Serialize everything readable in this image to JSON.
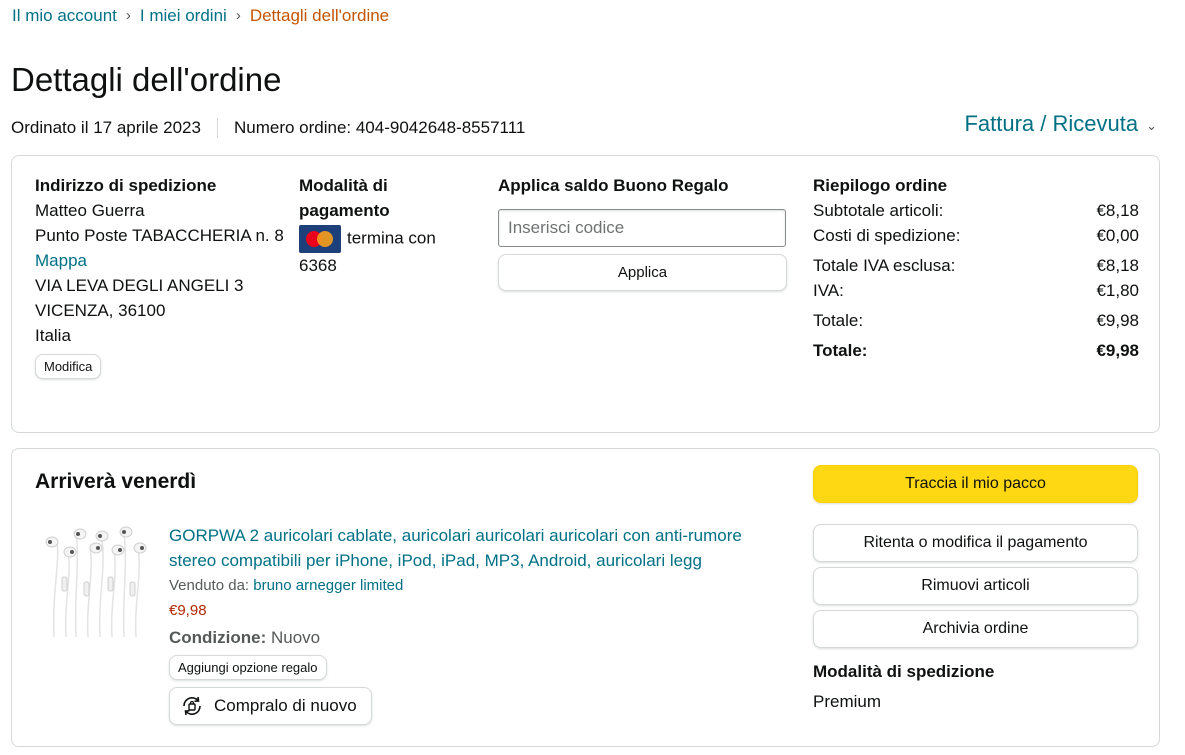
{
  "breadcrumb": {
    "items": [
      "Il mio account",
      "I miei ordini"
    ],
    "current": "Dettagli dell'ordine",
    "separator": "›"
  },
  "page": {
    "title": "Dettagli dell'ordine",
    "ordered_on": "Ordinato il 17 aprile 2023",
    "order_number": "Numero ordine: 404-9042648-8557111",
    "invoice_label": "Fattura / Ricevuta",
    "invoice_chevron_icon": "chevron-down-icon"
  },
  "shipping_address": {
    "title": "Indirizzo di spedizione",
    "name": "Matteo Guerra",
    "line1": "Punto Poste TABACCHERIA n. 8",
    "map_link": "Mappa",
    "line2": "VIA LEVA DEGLI ANGELI 3",
    "city": "VICENZA, 36100",
    "country": "Italia",
    "edit_button": "Modifica"
  },
  "payment": {
    "title_line1": "Modalità di",
    "title_line2": "pagamento",
    "card_icon": "mastercard-icon",
    "ending_text": "termina con",
    "last_digits": "6368"
  },
  "gift_card": {
    "title": "Applica saldo Buono Regalo",
    "placeholder": "Inserisci codice",
    "apply_button": "Applica"
  },
  "summary": {
    "title": "Riepilogo ordine",
    "rows": [
      {
        "label": "Subtotale articoli:",
        "value": "€8,18"
      },
      {
        "label": "Costi di spedizione:",
        "value": "€0,00"
      },
      {
        "label": "Totale IVA esclusa:",
        "value": "€8,18"
      },
      {
        "label": "IVA:",
        "value": "€1,80"
      },
      {
        "label": "Totale:",
        "value": "€9,98"
      },
      {
        "label": "Totale:",
        "value": "€9,98"
      }
    ]
  },
  "shipment": {
    "arrival_title": "Arriverà venerdì",
    "product_title": "GORPWA 2 auricolari cablate, auricolari auricolari auricolari con anti-rumore stereo compatibili per iPhone, iPod, iPad, MP3, Android, auricolari legg",
    "sold_by_label": "Venduto da:",
    "seller": "bruno arnegger limited",
    "price": "€9,98",
    "condition_label": "Condizione:",
    "condition_value": "Nuovo",
    "gift_option_button": "Aggiungi opzione regalo",
    "rebuy_button": "Compralo di nuovo",
    "rebuy_icon": "rebuy-icon",
    "product_image": "earphones-image"
  },
  "actions": {
    "track": "Traccia il mio pacco",
    "retry_payment": "Ritenta o modifica il pagamento",
    "remove_items": "Rimuovi articoli",
    "archive": "Archivia ordine"
  },
  "shipping_mode": {
    "title": "Modalità di spedizione",
    "value": "Premium"
  },
  "colors": {
    "link": "#007185",
    "breadcrumb_current": "#c45500",
    "price": "#b12704",
    "primary_button": "#ffd814",
    "border": "#d5d9d9"
  }
}
